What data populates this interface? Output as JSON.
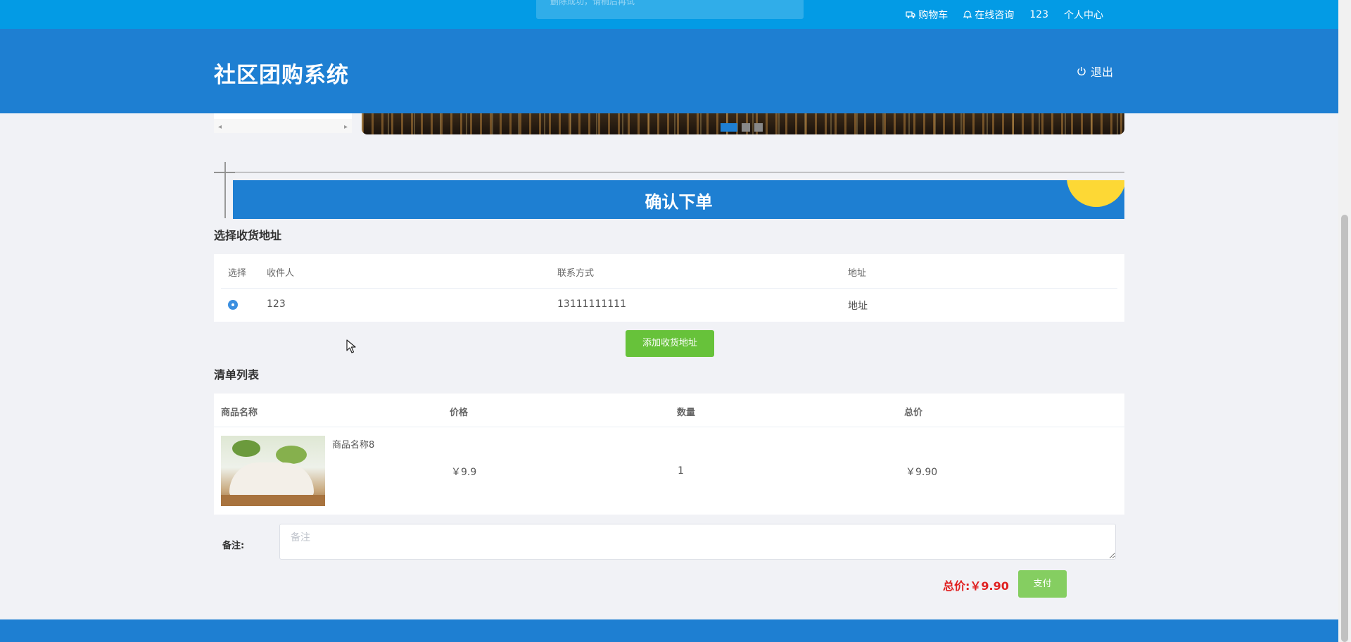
{
  "toast": {
    "text": "删除成功，请稍后再试"
  },
  "top_nav": {
    "cart": "购物车",
    "consult": "在线咨询",
    "username": "123",
    "profile": "个人中心"
  },
  "header": {
    "title": "社区团购系统",
    "logout": "退出"
  },
  "page_title": "确认下单",
  "address_section": {
    "heading": "选择收货地址",
    "columns": [
      "选择",
      "收件人",
      "联系方式",
      "地址"
    ],
    "rows": [
      {
        "name": "123",
        "phone": "13111111111",
        "address": "地址"
      }
    ],
    "add_button": "添加收货地址"
  },
  "order_section": {
    "heading": "清单列表",
    "columns": [
      "商品名称",
      "价格",
      "数量",
      "总价"
    ],
    "rows": [
      {
        "name": "商品名称8",
        "price": "￥9.9",
        "qty": "1",
        "subtotal": "￥9.90"
      }
    ]
  },
  "remark": {
    "label": "备注:",
    "placeholder": "备注"
  },
  "total": {
    "label": "总价:",
    "value": "￥9.90"
  },
  "pay_button": "支付",
  "carousel": {
    "slides": 3,
    "active_slide": 1
  },
  "colors": {
    "topbar": "#039be5",
    "header": "#1e7fd2",
    "accent_green": "#67c23a",
    "price_red": "#e02020",
    "sun": "#fdd835"
  }
}
